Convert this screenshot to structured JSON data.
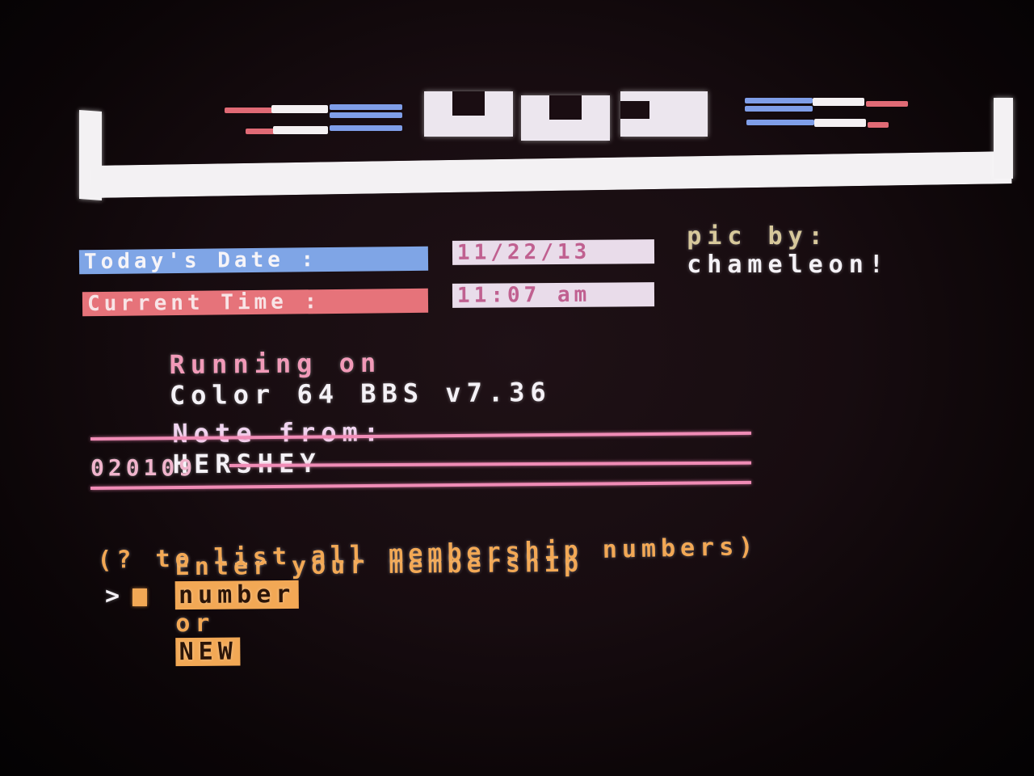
{
  "banner": {
    "credit_prefix": "pic by:",
    "credit_name": "chameleon!"
  },
  "status": {
    "date_label": "Today's Date :",
    "date_value": "11/22/13",
    "time_label": "Current Time :",
    "time_value": "11:07 am",
    "running_prefix": "Running on",
    "running_product": "Color 64 BBS v7.36"
  },
  "note": {
    "label": "Note from:",
    "author": "HERSHEY",
    "code": "020109"
  },
  "prompt": {
    "line1_prefix": "Enter your membership",
    "line1_highlight": "number",
    "line1_or": "or",
    "line1_new": "NEW",
    "line2": "(? to list all membership numbers)",
    "caret": ">"
  },
  "colors": {
    "frame": "#f3f1f3",
    "label_blue_bg": "#7fa5e6",
    "label_red_bg": "#e6737a",
    "value_bg": "#e9dcea",
    "pink_text": "#f19ab8",
    "orange_text": "#f2a855",
    "white_text": "#f4f1f6",
    "rule_pink": "#f08cb6"
  }
}
